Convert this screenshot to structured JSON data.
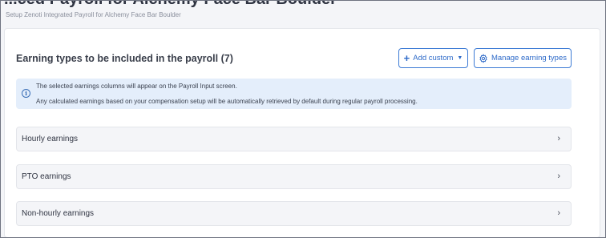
{
  "page": {
    "title": "...ced Payroll for Alchemy Face Bar Boulder",
    "subtitle": "Setup Zenoti Integrated Payroll for Alchemy Face Bar Boulder"
  },
  "section": {
    "title": "Earning types to be included in the payroll (7)"
  },
  "buttons": {
    "add_custom": "Add custom",
    "manage": "Manage earning types"
  },
  "info": {
    "line1": "The selected earnings columns will appear on the Payroll Input screen.",
    "line2": "Any calculated earnings based on your compensation setup will be automatically retrieved by default during regular payroll processing."
  },
  "accordions": [
    {
      "label": "Hourly earnings"
    },
    {
      "label": "PTO earnings"
    },
    {
      "label": "Non-hourly earnings"
    }
  ],
  "icons": {
    "plus": "plus-icon",
    "caret": "caret-down-icon",
    "gear": "gear-icon",
    "info": "info-icon",
    "chevron": "chevron-right-icon"
  },
  "colors": {
    "accent": "#2f6bc9",
    "info_bg": "#e4eefb",
    "page_bg": "#f4f5f8"
  }
}
